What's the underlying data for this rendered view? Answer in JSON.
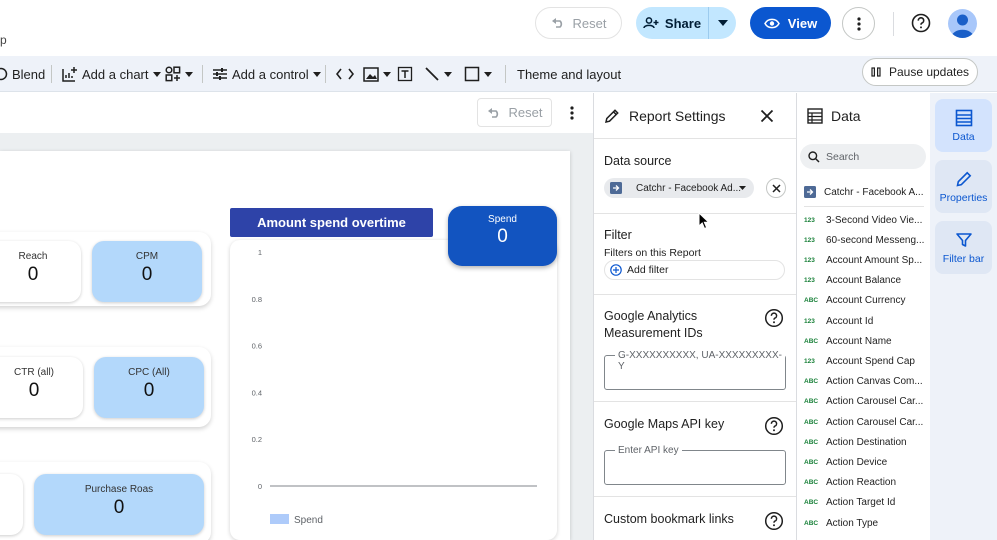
{
  "top_bar": {
    "title_fragment": "p",
    "reset_label": "Reset",
    "share_label": "Share",
    "view_label": "View"
  },
  "toolbar": {
    "blend_label": "Blend",
    "add_chart_label": "Add a chart",
    "add_control_label": "Add a control",
    "theme_label": "Theme and layout",
    "pause_label": "Pause updates"
  },
  "canvas": {
    "reset_label": "Reset",
    "kpis": [
      {
        "label": "Reach",
        "value": "0"
      },
      {
        "label": "CPM",
        "value": "0"
      },
      {
        "label": "CTR (all)",
        "value": "0"
      },
      {
        "label": "CPC (All)",
        "value": "0"
      },
      {
        "label": "Purchase Roas",
        "value": "0"
      }
    ],
    "spend_card": {
      "label": "Spend",
      "value": "0"
    }
  },
  "chart_data": {
    "type": "bar",
    "title": "Amount spend overtime",
    "categories": [],
    "series": [
      {
        "name": "Spend",
        "values": []
      }
    ],
    "y_ticks": [
      "1",
      "0.8",
      "0.6",
      "0.4",
      "0.2",
      "0"
    ],
    "ylim": [
      0,
      1
    ],
    "legend": "bottom-left",
    "series_color": "#aecbfa"
  },
  "report_settings": {
    "title": "Report Settings",
    "data_source_label": "Data source",
    "data_source_value": "Catchr - Facebook Ad...",
    "filter_label": "Filter",
    "filter_sub": "Filters on this Report",
    "add_filter_label": "Add filter",
    "ga_label_line1": "Google Analytics",
    "ga_label_line2": "Measurement IDs",
    "ga_placeholder": "G-XXXXXXXXXX, UA-XXXXXXXXX-Y",
    "maps_label": "Google Maps API key",
    "maps_placeholder": "Enter API key",
    "bookmark_label": "Custom bookmark links"
  },
  "data_panel": {
    "title": "Data",
    "search_placeholder": "Search",
    "source_name": "Catchr - Facebook A...",
    "fields": [
      {
        "type": "123",
        "name": "3-Second Video Vie..."
      },
      {
        "type": "123",
        "name": "60-second Messeng..."
      },
      {
        "type": "123",
        "name": "Account Amount Sp..."
      },
      {
        "type": "123",
        "name": "Account Balance"
      },
      {
        "type": "ABC",
        "name": "Account Currency"
      },
      {
        "type": "123",
        "name": "Account Id"
      },
      {
        "type": "ABC",
        "name": "Account Name"
      },
      {
        "type": "123",
        "name": "Account Spend Cap"
      },
      {
        "type": "ABC",
        "name": "Action Canvas Com..."
      },
      {
        "type": "ABC",
        "name": "Action Carousel Car..."
      },
      {
        "type": "ABC",
        "name": "Action Carousel Car..."
      },
      {
        "type": "ABC",
        "name": "Action Destination"
      },
      {
        "type": "ABC",
        "name": "Action Device"
      },
      {
        "type": "ABC",
        "name": "Action Reaction"
      },
      {
        "type": "ABC",
        "name": "Action Target Id"
      },
      {
        "type": "ABC",
        "name": "Action Type"
      }
    ]
  },
  "rail": {
    "data_label": "Data",
    "properties_label": "Properties",
    "filter_bar_label": "Filter bar"
  },
  "colors": {
    "accent": "#0b57d0",
    "share_bg": "#c2e7ff",
    "chart_title_bg": "#2e43a8",
    "spend_card_bg": "#1254c0",
    "kpi_blue": "#b3d8fb"
  }
}
